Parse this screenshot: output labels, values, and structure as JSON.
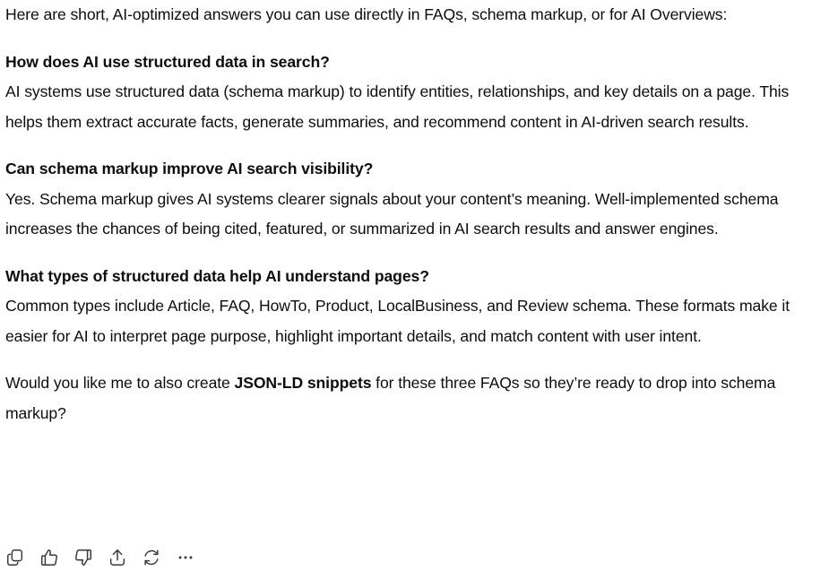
{
  "intro": "Here are short, AI-optimized answers you can use directly in FAQs, schema markup, or for AI Overviews:",
  "faqs": [
    {
      "question": "How does AI use structured data in search?",
      "answer": "AI systems use structured data (schema markup) to identify entities, relationships, and key details on a page. This helps them extract accurate facts, generate summaries, and recommend content in AI-driven search results."
    },
    {
      "question": "Can schema markup improve AI search visibility?",
      "answer": "Yes. Schema markup gives AI systems clearer signals about your content’s meaning. Well-implemented schema increases the chances of being cited, featured, or summarized in AI search results and answer engines."
    },
    {
      "question": "What types of structured data help AI understand pages?",
      "answer": "Common types include Article, FAQ, HowTo, Product, LocalBusiness, and Review schema. These formats make it easier for AI to interpret page purpose, highlight important details, and match content with user intent."
    }
  ],
  "outro": {
    "before": "Would you like me to also create ",
    "bold": "JSON-LD snippets",
    "after": " for these three FAQs so they’re ready to drop into schema markup?"
  },
  "actions": [
    {
      "icon": "copy-icon"
    },
    {
      "icon": "thumbs-up-icon"
    },
    {
      "icon": "thumbs-down-icon"
    },
    {
      "icon": "share-icon"
    },
    {
      "icon": "regenerate-icon"
    },
    {
      "icon": "more-icon"
    }
  ]
}
